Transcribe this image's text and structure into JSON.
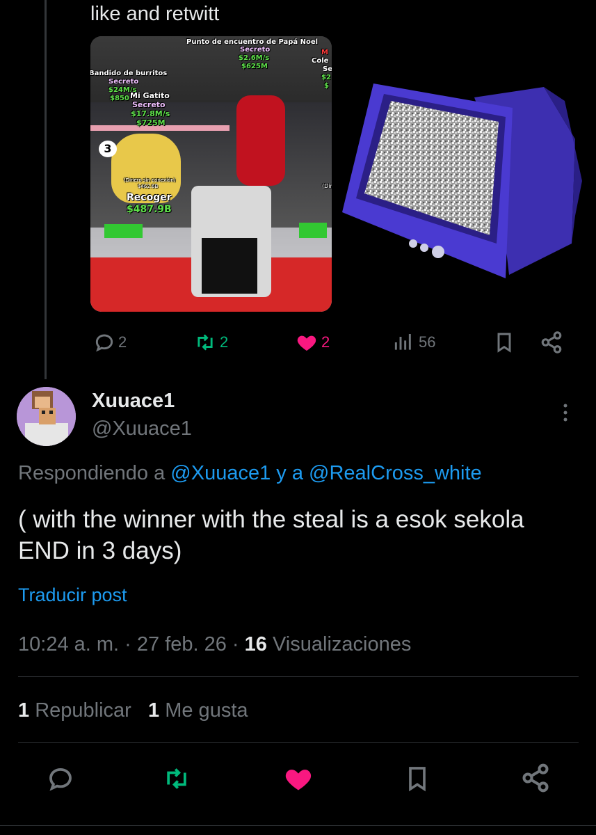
{
  "previous_post": {
    "text": "like and retwitt",
    "media": {
      "top_sign": "Punto de encuentro de Papá Noel",
      "top_rarity": "Secreto",
      "top_rate": "$2.6M/s",
      "top_price": "$625M",
      "right_cut_1": "M",
      "right_cut_2": "Cole",
      "right_cut_3": "Se",
      "right_cut_4": "$2",
      "right_cut_5": "$",
      "left_name": "Bandido de burritos",
      "left_rarity": "Secreto",
      "left_rate": "$24M/s",
      "left_price": "$850",
      "cat_name": "Mi Gatito",
      "cat_rarity": "Secreto",
      "cat_rate": "$17.8M/s",
      "cat_price": "$725M",
      "badge_number": "3",
      "offline_label": "(Dinero sin conexión)",
      "offline_value": "$462.6B",
      "collect_label": "Recoger",
      "collect_value": "$487.9B",
      "right_small": "(Din"
    },
    "actions": {
      "replies": "2",
      "reposts": "2",
      "likes": "2",
      "views": "56"
    }
  },
  "reply": {
    "display_name": "Xuuace1",
    "handle": "@Xuuace1",
    "replying_prefix": "Respondiendo a",
    "replying_user1": "@Xuuace1",
    "replying_and": "y a",
    "replying_user2": "@RealCross_white",
    "text": "( with the winner with the steal is a esok sekola END in 3 days)",
    "translate": "Traducir post",
    "time": "10:24 a. m.",
    "date": "27 feb. 26",
    "views_count": "16",
    "views_label": "Visualizaciones",
    "reposts_count": "1",
    "reposts_label": "Republicar",
    "likes_count": "1",
    "likes_label": "Me gusta"
  },
  "colors": {
    "background": "#000000",
    "text": "#e7e9ea",
    "muted": "#71767b",
    "link": "#1d9bf0",
    "repost_green": "#00ba7c",
    "like_pink": "#f91880"
  }
}
